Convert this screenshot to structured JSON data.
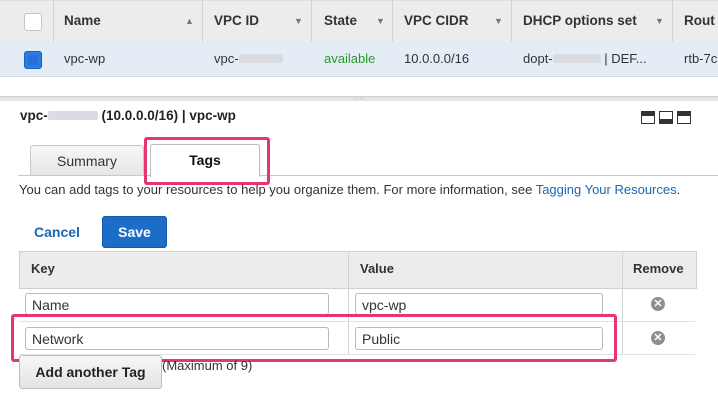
{
  "vpc_table": {
    "columns": [
      {
        "label": "Name"
      },
      {
        "label": "VPC ID"
      },
      {
        "label": "State"
      },
      {
        "label": "VPC CIDR"
      },
      {
        "label": "DHCP options set"
      },
      {
        "label": "Rout"
      }
    ],
    "row": {
      "name": "vpc-wp",
      "vpc_id_prefix": "vpc-",
      "state": "available",
      "cidr": "10.0.0.0/16",
      "dhcp_prefix": "dopt-",
      "dhcp_suffix": " | DEF...",
      "route": "rtb-7c"
    },
    "state_color": "#2a9a2a"
  },
  "detail": {
    "title_prefix": "vpc-",
    "title_suffix": " (10.0.0.0/16) | vpc-wp",
    "tabs": [
      {
        "label": "Summary"
      },
      {
        "label": "Tags"
      }
    ],
    "info_text": "You can add tags to your resources to help you organize them. For more information, see ",
    "info_link": "Tagging Your Resources",
    "info_end": ".",
    "cancel_label": "Cancel",
    "save_label": "Save",
    "tag_table": {
      "headers": {
        "key": "Key",
        "value": "Value",
        "remove": "Remove"
      },
      "rows": [
        {
          "key": "Name",
          "value": "vpc-wp"
        },
        {
          "key": "Network",
          "value": "Public"
        }
      ]
    },
    "add_tag_label": "Add another Tag",
    "max_note": "(Maximum of 9)"
  },
  "colors": {
    "accent": "#1c6cc9",
    "highlight": "#e8366c",
    "link": "#1a66b4"
  }
}
